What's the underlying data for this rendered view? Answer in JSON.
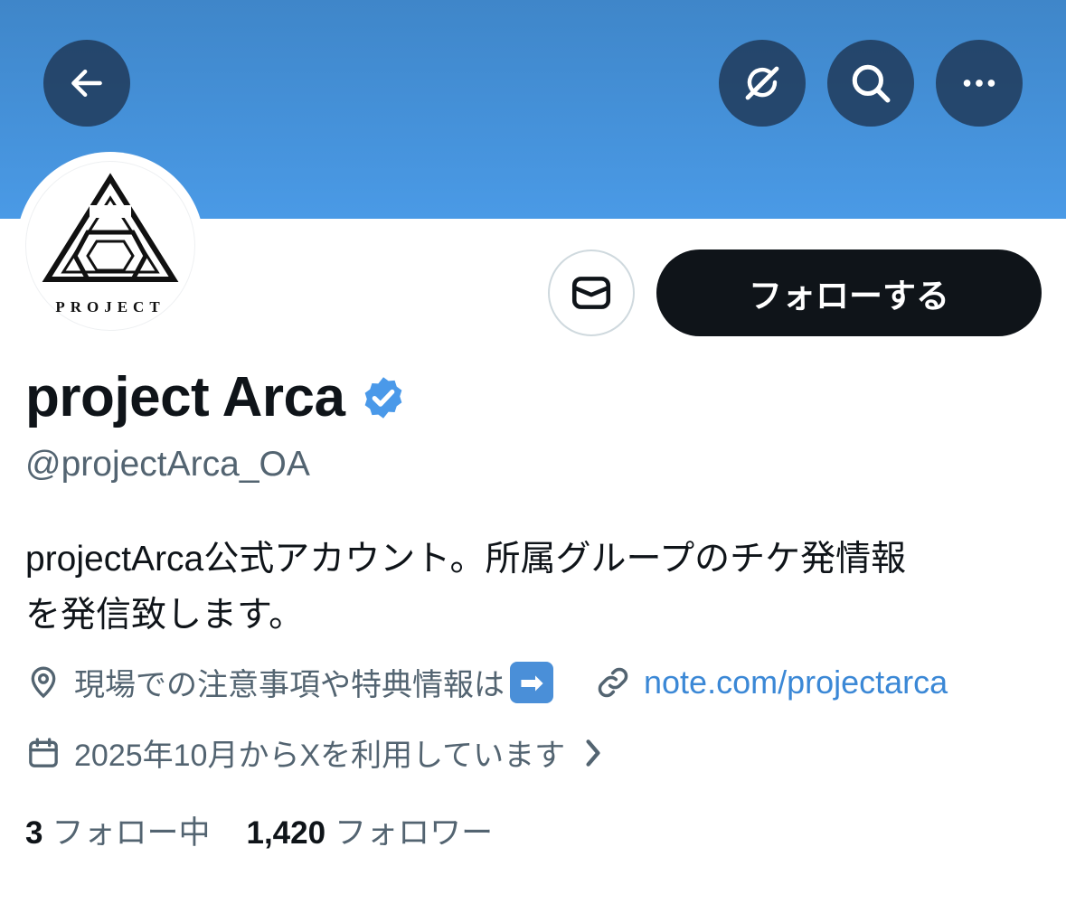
{
  "header": {
    "back_icon": "arrow-left-icon",
    "grok_icon": "grok-icon",
    "search_icon": "search-icon",
    "more_icon": "more-horizontal-icon",
    "banner_color": "#4a9ae6"
  },
  "profile": {
    "avatar_text": "PROJECT",
    "follow_label": "フォローする",
    "message_icon": "envelope-icon",
    "display_name": "project Arca",
    "verified_icon": "verified-badge-icon",
    "handle": "@projectArca_OA",
    "bio_line1": "projectArca公式アカウント。所属グループのチケ発情報",
    "bio_line2": "を発信致します。",
    "location_text": "現場での注意事項や特典情報は",
    "location_emoji": "➡",
    "link_text": "note.com/projectarca",
    "joined_text": "2025年10月からXを利用しています"
  },
  "stats": {
    "following_count": "3",
    "following_label": "フォロー中",
    "followers_count": "1,420",
    "followers_label": "フォロワー"
  }
}
